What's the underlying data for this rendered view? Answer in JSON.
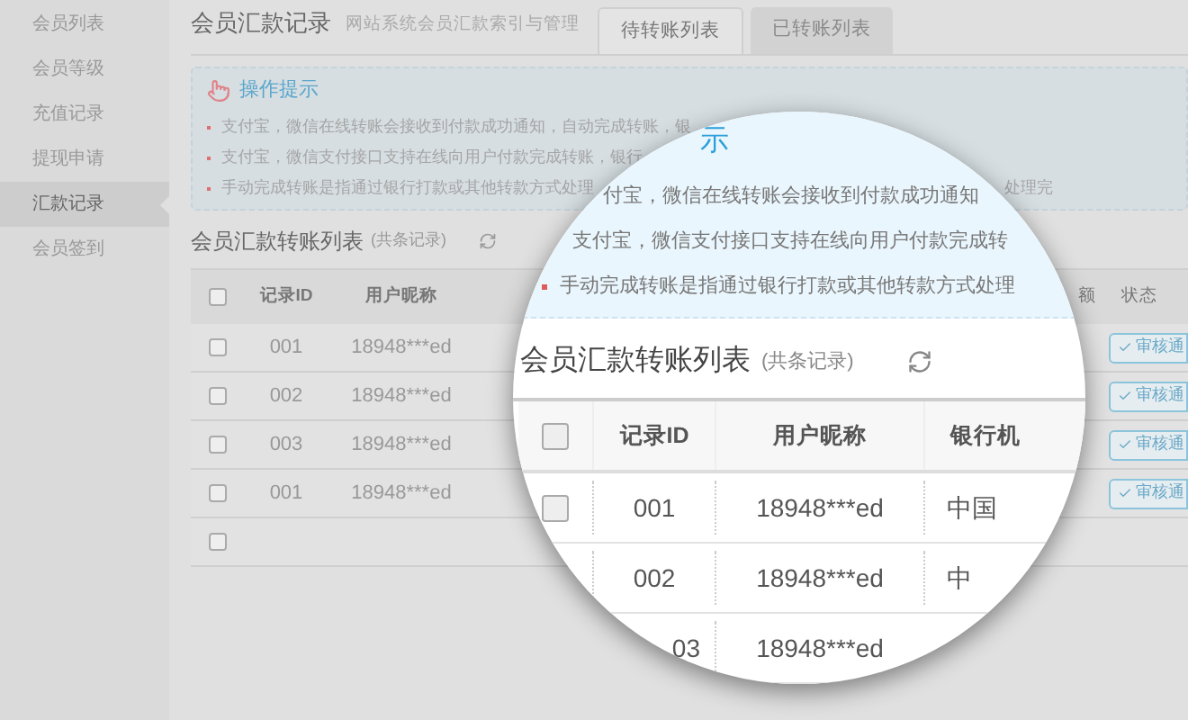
{
  "sidebar": {
    "items": [
      {
        "label": "会员列表",
        "selected": false
      },
      {
        "label": "会员等级",
        "selected": false
      },
      {
        "label": "充值记录",
        "selected": false
      },
      {
        "label": "提现申请",
        "selected": false
      },
      {
        "label": "汇款记录",
        "selected": true
      },
      {
        "label": "会员签到",
        "selected": false
      }
    ]
  },
  "header": {
    "title": "会员汇款记录",
    "subtitle": "网站系统会员汇款索引与管理",
    "tabs": [
      {
        "label": "待转账列表",
        "selected": true
      },
      {
        "label": "已转账列表",
        "selected": false
      }
    ]
  },
  "tips": {
    "title": "操作提示",
    "lines": [
      {
        "text": "支付宝，微信在线转账会接收到付款成功通知，自动完成转账，银"
      },
      {
        "text": "支付宝，微信支付接口支持在线向用户付款完成转账，银行"
      },
      {
        "text": "手动完成转账是指通过银行打款或其他转款方式处理",
        "tail": "处理完"
      }
    ]
  },
  "table": {
    "title": "会员汇款转账列表",
    "count_note": "(共条记录)",
    "header_checked": false,
    "columns": [
      "记录ID",
      "用户昵称",
      "额",
      "状态"
    ],
    "rows": [
      {
        "checked": false,
        "id": "001",
        "nickname": "18948***ed",
        "action": "审核通"
      },
      {
        "checked": false,
        "id": "002",
        "nickname": "18948***ed",
        "action": "审核通"
      },
      {
        "checked": false,
        "id": "003",
        "nickname": "18948***ed",
        "action": "审核通"
      },
      {
        "checked": false,
        "id": "001",
        "nickname": "18948***ed",
        "action": "审核通"
      },
      {
        "checked": false
      }
    ]
  },
  "magnifier": {
    "tips_title": "示",
    "tips_lines": [
      {
        "text": "付宝，微信在线转账会接收到付款成功通知",
        "bullet": false
      },
      {
        "text": "支付宝，微信支付接口支持在线向用户付款完成转",
        "bullet": false
      },
      {
        "text": "手动完成转账是指通过银行打款或其他转款方式处理",
        "bullet": true
      }
    ],
    "table_title": "会员汇款转账列表",
    "count_note": "(共条记录)",
    "header_checked": false,
    "columns": [
      "记录ID",
      "用户昵称",
      "银行机"
    ],
    "rows": [
      {
        "checked": false,
        "id": "001",
        "nickname": "18948***ed",
        "bank": "中国"
      },
      {
        "id": "002",
        "nickname": "18948***ed",
        "bank": "中"
      },
      {
        "id": "03",
        "nickname": "18948***ed"
      }
    ]
  }
}
